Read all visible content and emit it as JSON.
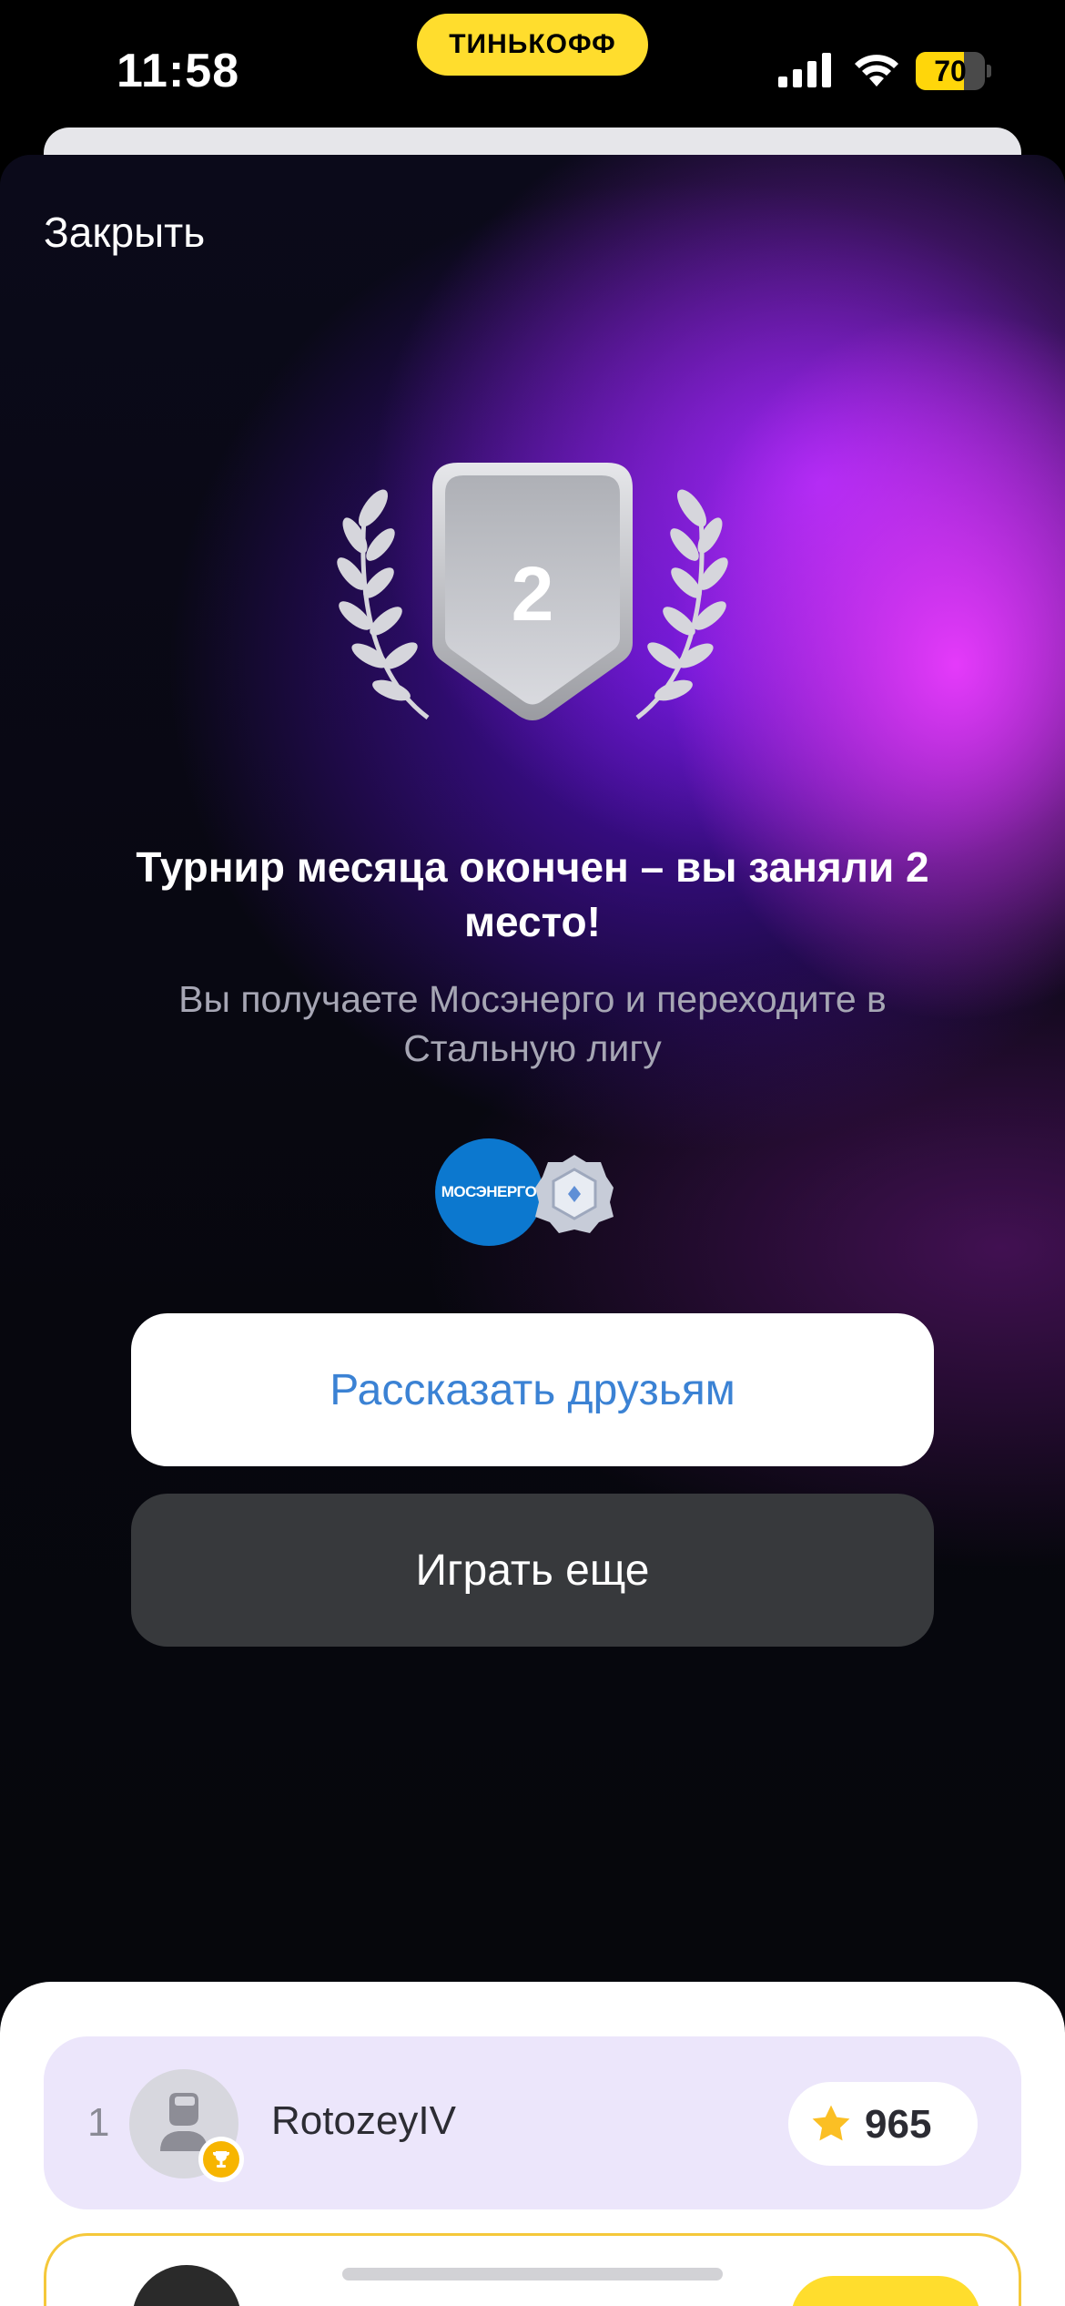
{
  "status_bar": {
    "time": "11:58",
    "carrier_badge": "ТИНЬКОФФ",
    "battery": "70",
    "battery_level": 0.7,
    "battery_color": "#ffd60a"
  },
  "modal": {
    "close_label": "Закрыть",
    "place_number": "2",
    "title": "Турнир месяца окончен – вы заняли 2 место!",
    "subtitle": "Вы получаете Мосэнерго и переходите в Стальную лигу",
    "reward_logo_text": "МОСЭНЕРГО",
    "share_button": "Рассказать друзьям",
    "play_button": "Играть еще"
  },
  "leaderboard": {
    "rows": [
      {
        "rank": "1",
        "name": "RotozeyIV",
        "score": "965"
      }
    ]
  },
  "colors": {
    "accent_yellow": "#ffdd2d",
    "share_text": "#3b82d4",
    "highlight_row": "#ece6fb",
    "gradient_magenta": "#ec3cff",
    "gradient_violet": "#5c10dc"
  }
}
